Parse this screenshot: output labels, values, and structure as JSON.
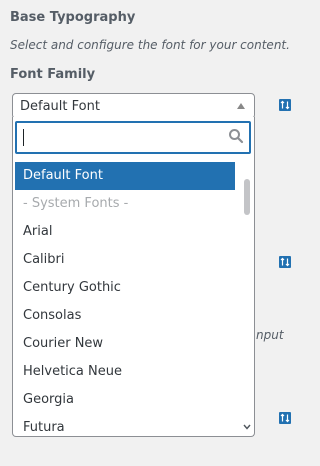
{
  "section": {
    "title": "Base Typography",
    "description": "Select and configure the font for your content."
  },
  "field": {
    "label": "Font Family",
    "selected": "Default Font"
  },
  "background_partial_text": "nput",
  "dropdown": {
    "search_value": "",
    "options": [
      {
        "label": "Default Font",
        "state": "selected"
      },
      {
        "label": "- System Fonts -",
        "state": "group-header"
      },
      {
        "label": "Arial",
        "state": "normal"
      },
      {
        "label": "Calibri",
        "state": "normal"
      },
      {
        "label": "Century Gothic",
        "state": "normal"
      },
      {
        "label": "Consolas",
        "state": "normal"
      },
      {
        "label": "Courier New",
        "state": "normal"
      },
      {
        "label": "Helvetica Neue",
        "state": "normal"
      },
      {
        "label": "Georgia",
        "state": "normal"
      },
      {
        "label": "Futura",
        "state": "normal"
      }
    ]
  },
  "icons": {
    "responsive_toggle": "arrows-up-down-icon",
    "search": "search-icon",
    "scroll_down": "chevron-down-icon"
  },
  "colors": {
    "accent": "#2271b1",
    "selected_text": "#ffffff",
    "group_header_text": "#a7aaad",
    "page_background": "#f1f1f1"
  }
}
